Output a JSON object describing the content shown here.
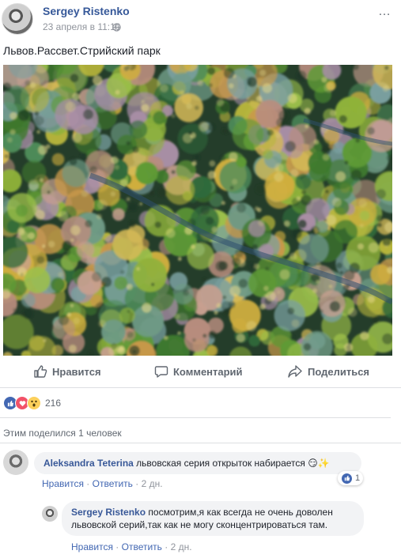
{
  "post": {
    "author": "Sergey Ristenko",
    "timestamp": "23 апреля в 11:10",
    "text": "Львов.Рассвет.Стрийский парк",
    "more_icon": "…"
  },
  "actions": {
    "like": "Нравится",
    "comment": "Комментарий",
    "share": "Поделиться"
  },
  "reactions": {
    "types": [
      "like",
      "love",
      "wow"
    ],
    "count": "216"
  },
  "shares": "Этим поделился 1 человек",
  "comments": [
    {
      "author": "Aleksandra Teterina",
      "text": "львовская серия открыток набирается",
      "emoji": "😏✨",
      "reaction_count": "1",
      "like": "Нравится",
      "reply": "Ответить",
      "time": "2 дн.",
      "sep": "·"
    },
    {
      "author": "Sergey Ristenko",
      "text": "посмотрим,я как всегда не очень доволен львовской серий,так как не могу сконцентрироваться там.",
      "like": "Нравится",
      "reply": "Ответить",
      "time": "2 дн.",
      "sep": "·"
    }
  ],
  "colors": {
    "link": "#365899",
    "like_blue": "#4267b2",
    "love_red": "#f25268",
    "wow_yellow": "#fcd05b"
  }
}
